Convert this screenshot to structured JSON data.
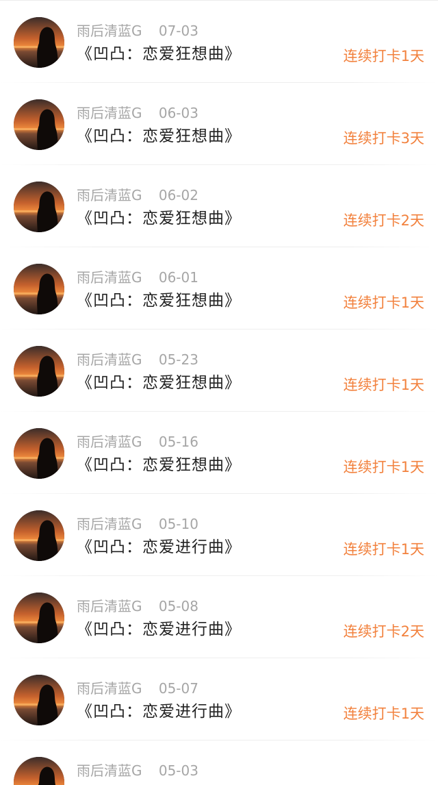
{
  "accent_color": "#f2813d",
  "records": [
    {
      "user": "雨后清蓝G",
      "date": "07-03",
      "title": "《凹凸：恋爱狂想曲》",
      "streak": "连续打卡1天"
    },
    {
      "user": "雨后清蓝G",
      "date": "06-03",
      "title": "《凹凸：恋爱狂想曲》",
      "streak": "连续打卡3天"
    },
    {
      "user": "雨后清蓝G",
      "date": "06-02",
      "title": "《凹凸：恋爱狂想曲》",
      "streak": "连续打卡2天"
    },
    {
      "user": "雨后清蓝G",
      "date": "06-01",
      "title": "《凹凸：恋爱狂想曲》",
      "streak": "连续打卡1天"
    },
    {
      "user": "雨后清蓝G",
      "date": "05-23",
      "title": "《凹凸：恋爱狂想曲》",
      "streak": "连续打卡1天"
    },
    {
      "user": "雨后清蓝G",
      "date": "05-16",
      "title": "《凹凸：恋爱狂想曲》",
      "streak": "连续打卡1天"
    },
    {
      "user": "雨后清蓝G",
      "date": "05-10",
      "title": "《凹凸：恋爱进行曲》",
      "streak": "连续打卡1天"
    },
    {
      "user": "雨后清蓝G",
      "date": "05-08",
      "title": "《凹凸：恋爱进行曲》",
      "streak": "连续打卡2天"
    },
    {
      "user": "雨后清蓝G",
      "date": "05-07",
      "title": "《凹凸：恋爱进行曲》",
      "streak": "连续打卡1天"
    },
    {
      "user": "雨后清蓝G",
      "date": "05-03",
      "title": "",
      "streak": ""
    }
  ]
}
